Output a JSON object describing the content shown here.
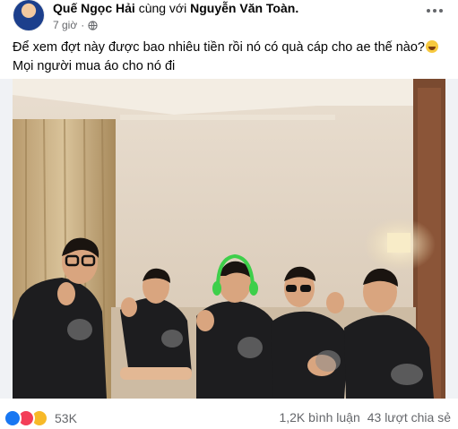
{
  "post": {
    "author": "Quế Ngọc Hải",
    "with_text": "cùng với",
    "tagged": "Nguyễn Văn Toàn.",
    "time": "7 giờ",
    "separator": "·",
    "text_line1": "Để xem đợt này được bao nhiêu tiền rồi nó có quà cáp cho ae thế nào?",
    "text_line2": "Mọi người mua áo cho nó đi"
  },
  "icons": {
    "avatar": "avatar",
    "privacy": "globe-icon",
    "more": "more-options-icon",
    "emoji": "laughing-emoji-icon",
    "reactions": [
      "like-icon",
      "love-icon",
      "haha-icon"
    ]
  },
  "footer": {
    "reaction_count": "53K",
    "comments": "1,2K bình luận",
    "shares": "43 lượt chia sẻ"
  },
  "colors": {
    "secondary_text": "#65676b",
    "like_blue": "#1877f2",
    "love_red": "#f33e58",
    "haha_yellow": "#f7b928",
    "headset_green": "#3ecf4a"
  }
}
